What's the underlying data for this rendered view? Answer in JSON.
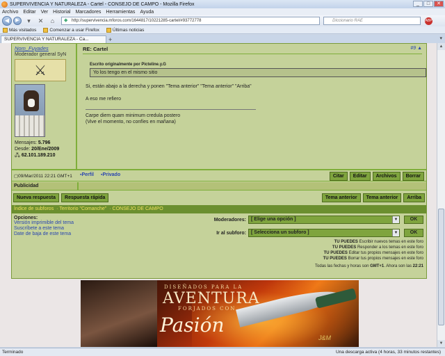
{
  "window": {
    "title": "SUPERVIVENCIA Y NATURALEZA - Cartel - CONSEJO DE CAMPO - Mozilla Firefox",
    "min": "_",
    "max": "□",
    "close": "✕"
  },
  "menu": [
    "Archivo",
    "Editar",
    "Ver",
    "Historial",
    "Marcadores",
    "Herramientas",
    "Ayuda"
  ],
  "nav": {
    "url": "http://supervivencia.mforos.com/1644817/10221285-cartel/#93772778",
    "search_placeholder": "Diccionario RAE",
    "abp_label": "ABP"
  },
  "bookmarks": [
    "Más visitados",
    "Comenzar a usar Firefox",
    "Últimas noticias"
  ],
  "tab": {
    "label": "SUPERVIVENCIA Y NATURALEZA - Ca...",
    "add": "+",
    "list": "▾"
  },
  "user": {
    "name": "Nom_Fuyades",
    "rank": "Moderador general SyN",
    "mensajes_label": "Mensajes:",
    "mensajes": "5.796",
    "desde_label": "Desde:",
    "desde": "20/Ene/2009",
    "ip": "62.101.189.210"
  },
  "post": {
    "title": "RE: Cartel",
    "number": "#9",
    "quote_header": "Escrito originalmente por Picteline.y.G",
    "quote_text": "Yo los tengo en el mismo sitio",
    "line1": "Si, están abajo a la derecha y ponen \"Tema anterior\" \"Tema anterior\" \"Arriba\"",
    "line2": "A eso me refiero",
    "sig1": "Carpe diem quam minimum credula postero",
    "sig2": "(Vive el momento, no confíes en mañana)",
    "date": "09/Mar/2011 22:21 GMT+1",
    "perfil": "Perfil",
    "privado": "Privado"
  },
  "post_buttons": [
    "Citar",
    "Editar",
    "Archivos",
    "Borrar"
  ],
  "publicidad": "Publicidad",
  "action_left": [
    "Nueva respuesta",
    "Respuesta rápida"
  ],
  "action_right": [
    "Tema anterior",
    "Tema anterior",
    "Arriba"
  ],
  "breadcrumb": [
    "Índice de subforos",
    "Territorio \"Comanche\"",
    "CONSEJO DE CAMPO"
  ],
  "options": {
    "title": "Opciones:",
    "links": [
      "Versión imprimible del tema",
      "Suscríbete a este tema",
      "Date de baja de este tema"
    ],
    "mod_label": "Moderadores:",
    "mod_value": "[ Elige una opción ]",
    "goto_label": "Ir al subforo:",
    "goto_value": "[ Selecciona un subforo ]",
    "ok": "OK",
    "perms": [
      {
        "b": "TU PUEDES",
        "t": "Escribir nuevos temas en este foro"
      },
      {
        "b": "TU PUEDES",
        "t": "Responder a los temas en este foro"
      },
      {
        "b": "TU PUEDES",
        "t": "Editar tus propios mensajes en este foro"
      },
      {
        "b": "TU PUEDES",
        "t": "Borrar tus propios mensajes en este foro"
      }
    ],
    "tz": "Todas las fechas y horas son",
    "tz_b": "GMT+1",
    "tz2": ". Ahora son las",
    "now": "22:21"
  },
  "banner": {
    "l1": "DISEÑADOS PARA LA",
    "l2": "AVENTURA",
    "l3": "FORJADOS CON",
    "l4": "Pasión",
    "brand": "J&M"
  },
  "status": {
    "left": "Terminado",
    "right": "Una descarga activa (4 horas, 33 minutos restantes)"
  }
}
